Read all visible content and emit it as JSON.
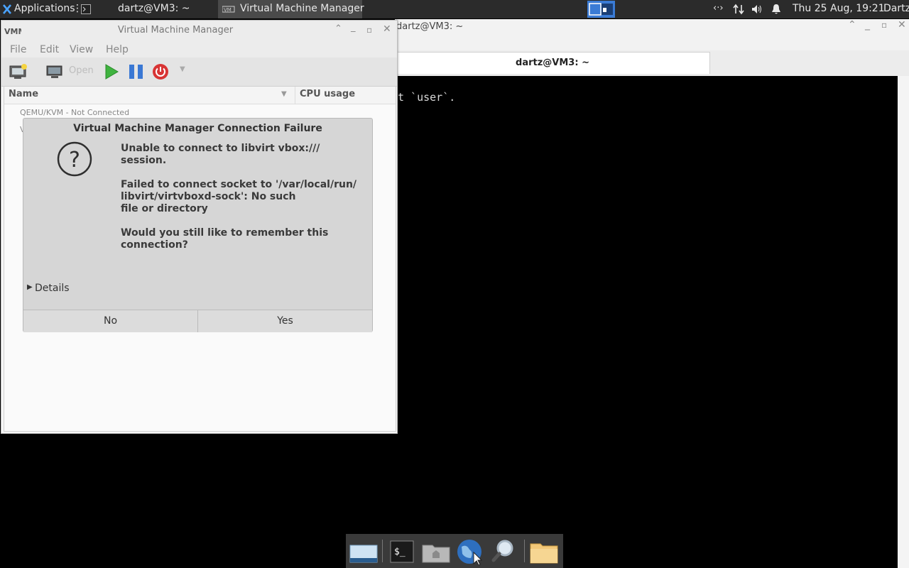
{
  "panel": {
    "applications_label": "Applications",
    "task_terminal_label": "dartz@VM3: ~",
    "task_vmm_label": "Virtual Machine Manager",
    "clock": "Thu 25 Aug, 19:21",
    "user": "Dartz"
  },
  "terminal": {
    "title": "dartz@VM3: ~",
    "tab_label": "dartz@VM3: ~",
    "line": "t `user`."
  },
  "vmm": {
    "title": "Virtual Machine Manager",
    "menu": [
      "File",
      "Edit",
      "View",
      "Help"
    ],
    "open_label": "Open",
    "columns": {
      "name": "Name",
      "cpu": "CPU usage"
    },
    "connection_row": "QEMU/KVM - Not Connected",
    "row2_fragment": "V"
  },
  "dialog": {
    "title": "Virtual Machine Manager Connection Failure",
    "line1": "Unable to connect to libvirt vbox:///",
    "line2": "session.",
    "line3": "Failed to connect socket to '/var/local/run/",
    "line4": "libvirt/virtvboxd-sock': No such",
    "line5": "file or directory",
    "line6": "Would you still like to remember this",
    "line7": "connection?",
    "details_label": "Details",
    "no_label": "No",
    "yes_label": "Yes"
  },
  "colors": {
    "accent": "#3a7bd5",
    "run_green": "#3fb33f",
    "pause_blue": "#3a78d4",
    "power_red": "#d83434"
  },
  "dock": {
    "items": [
      "desktop-icon",
      "terminal-icon",
      "home-folder-icon",
      "web-browser-icon",
      "search-icon",
      "files-icon"
    ]
  }
}
